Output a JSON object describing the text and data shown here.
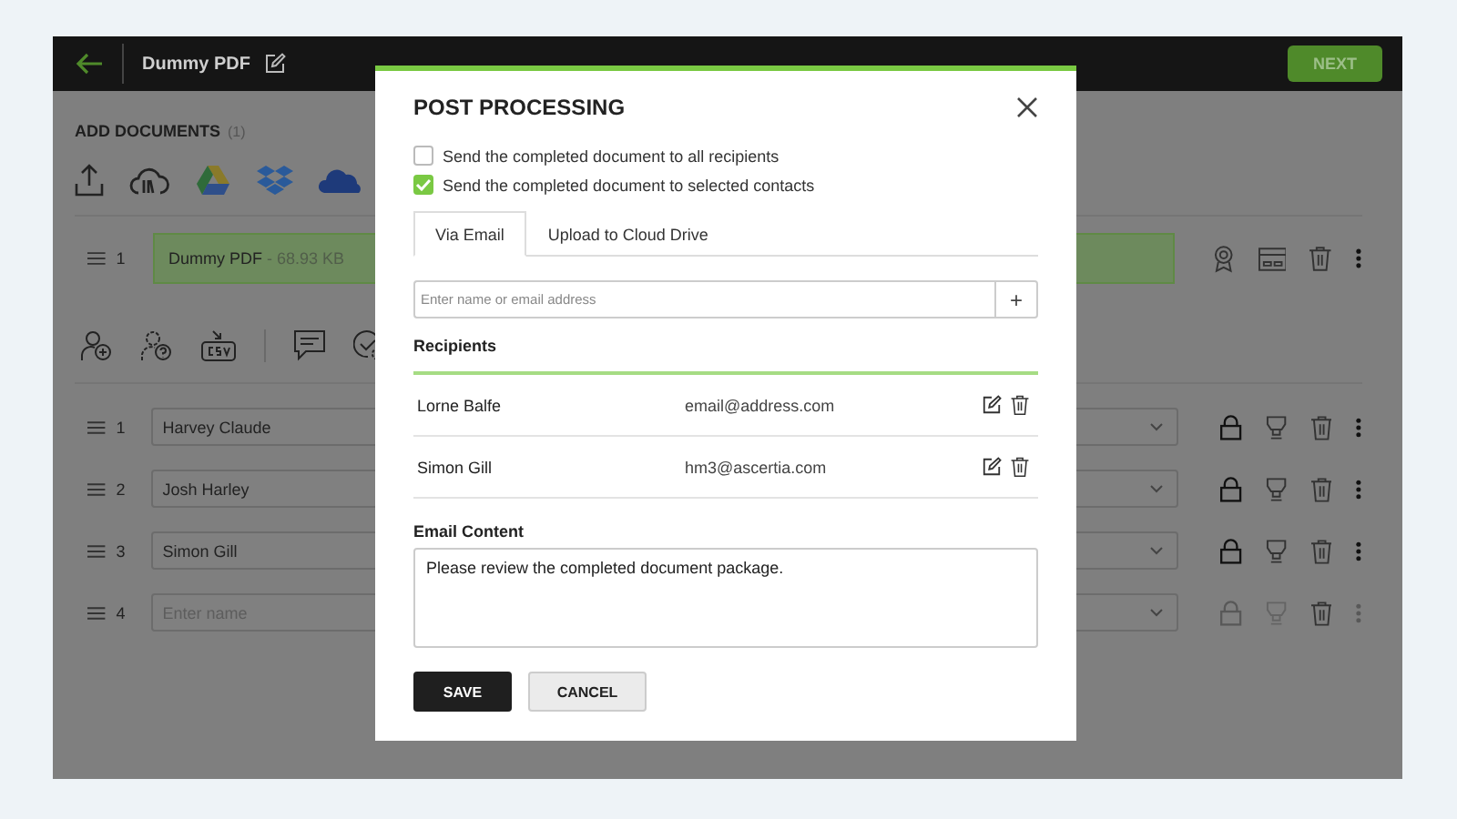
{
  "header": {
    "title": "Dummy PDF",
    "next_button": "NEXT"
  },
  "documents": {
    "heading": "ADD DOCUMENTS",
    "count": "(1)",
    "items": [
      {
        "index": "1",
        "name": "Dummy PDF",
        "size": "- 68.93 KB"
      }
    ]
  },
  "signers": [
    {
      "index": "1",
      "name": "Harvey Claude",
      "disabled": false
    },
    {
      "index": "2",
      "name": "Josh Harley",
      "disabled": false
    },
    {
      "index": "3",
      "name": "Simon Gill",
      "disabled": false
    },
    {
      "index": "4",
      "placeholder": "Enter name",
      "disabled": true
    }
  ],
  "dialog": {
    "title": "POST PROCESSING",
    "options": [
      {
        "label": "Send the completed document to all recipients",
        "checked": false
      },
      {
        "label": "Send the completed document to selected contacts",
        "checked": true
      }
    ],
    "tabs": [
      {
        "label": "Via Email",
        "selected": true
      },
      {
        "label": "Upload to Cloud Drive",
        "selected": false
      }
    ],
    "contact_input": {
      "placeholder": "Enter name or email address",
      "add_button": "+"
    },
    "recipients_heading": "Recipients",
    "recipients": [
      {
        "name": "Lorne Balfe",
        "email": "email@address.com"
      },
      {
        "name": "Simon Gill",
        "email": "hm3@ascertia.com"
      }
    ],
    "email_content": {
      "label": "Email Content",
      "value": "Please review the completed document package."
    },
    "buttons": [
      {
        "label": "SAVE",
        "kind": "primary"
      },
      {
        "label": "CANCEL",
        "kind": "secondary"
      }
    ]
  }
}
